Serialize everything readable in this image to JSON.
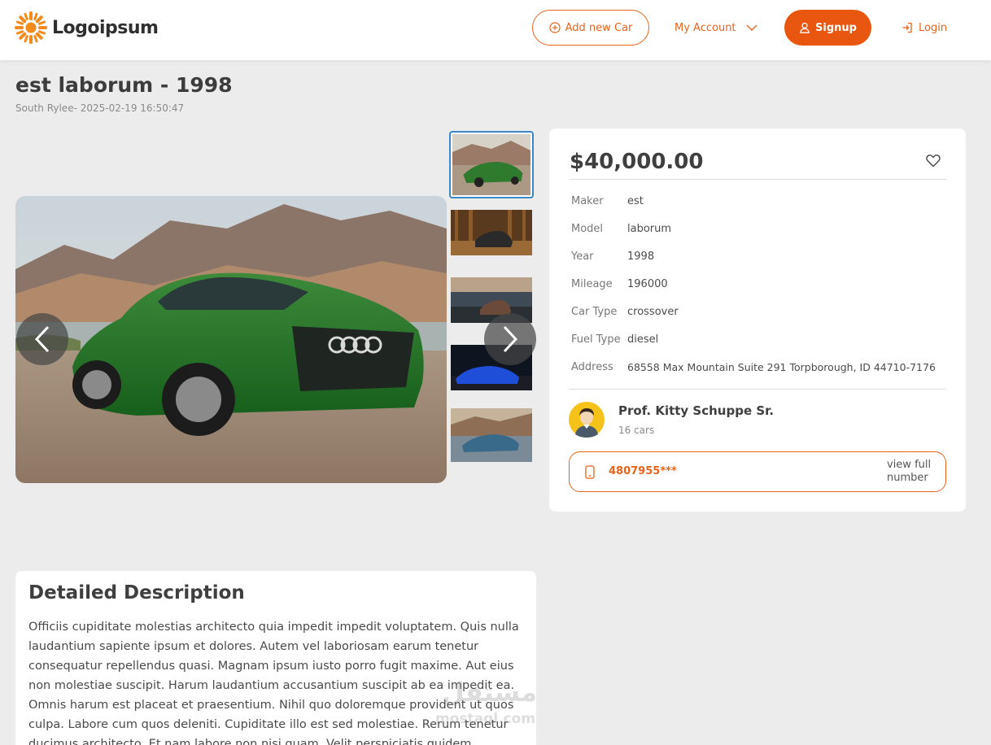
{
  "header": {
    "logo_text": "Logoipsum",
    "add_car_label": "Add new Car",
    "account_label": "My Account",
    "signup_label": "Signup",
    "login_label": "Login"
  },
  "listing": {
    "title": "est laborum - 1998",
    "subtitle": "South Rylee- 2025-02-19 16:50:47"
  },
  "details": {
    "price": "$40,000.00",
    "specs": [
      {
        "label": "Maker",
        "value": "est"
      },
      {
        "label": "Model",
        "value": "laborum"
      },
      {
        "label": "Year",
        "value": "1998"
      },
      {
        "label": "Mileage",
        "value": "196000"
      },
      {
        "label": "Car Type",
        "value": "crossover"
      },
      {
        "label": "Fuel Type",
        "value": "diesel"
      },
      {
        "label": "Address",
        "value": "68558 Max Mountain Suite 291 Torpborough, ID 44710-7176"
      }
    ],
    "seller_name": "Prof. Kitty Schuppe Sr.",
    "seller_cars": "16 cars",
    "phone": "4807955***",
    "view_full": "view full number"
  },
  "description": {
    "title": "Detailed Description",
    "text": "Officiis cupiditate molestias architecto quia impedit impedit voluptatem. Quis nulla laudantium sapiente ipsum et dolores. Autem vel laboriosam earum tenetur consequatur repellendus quasi. Magnam ipsum iusto porro fugit maxime. Aut eius non molestiae suscipit. Harum laudantium accusantium suscipit ab ea impedit ea. Omnis harum est placeat et praesentium. Nihil quo doloremque provident ut quos culpa. Labore cum quos deleniti. Cupiditate illo est sed molestiae. Rerum tenetur ducimus architecto. Et nam labore non nisi quam. Velit perspiciatis quidem reiciendis"
  },
  "watermark": {
    "arabic": "مستقل",
    "latin": "mostaql.com"
  },
  "colors": {
    "accent": "#e8631b",
    "accent_solid": "#e8560f",
    "active_thumb_border": "#3a88c9",
    "background": "#ececec"
  },
  "icons": [
    "plus-circle-icon",
    "chevron-down-icon",
    "user-icon",
    "login-icon",
    "heart-icon",
    "phone-icon",
    "chevron-left-icon",
    "chevron-right-icon"
  ]
}
